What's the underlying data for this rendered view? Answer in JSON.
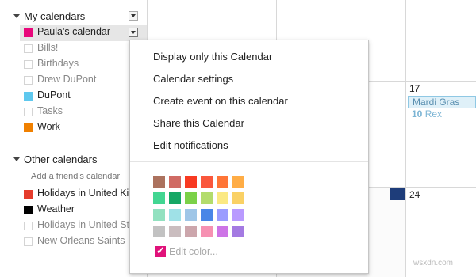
{
  "sidebar": {
    "my_calendars": {
      "title": "My calendars",
      "items": [
        {
          "label": "Paula's calendar",
          "color": "#e8087b",
          "checked": true,
          "active": true
        },
        {
          "label": "Bills!",
          "color": null,
          "checked": false
        },
        {
          "label": "Birthdays",
          "color": null,
          "checked": false
        },
        {
          "label": "Drew DuPont",
          "color": null,
          "checked": false
        },
        {
          "label": "DuPont",
          "color": "#5ec8ee",
          "checked": true
        },
        {
          "label": "Tasks",
          "color": null,
          "checked": false
        },
        {
          "label": "Work",
          "color": "#f08000",
          "checked": true
        }
      ]
    },
    "other_calendars": {
      "title": "Other calendars",
      "friend_placeholder": "Add a friend's calendar",
      "items": [
        {
          "label": "Holidays in United Ki",
          "color": "#e53c2c",
          "checked": true
        },
        {
          "label": "Weather",
          "color": "#000000",
          "checked": true
        },
        {
          "label": "Holidays in United St",
          "color": null,
          "checked": false
        },
        {
          "label": "New Orleans Saints",
          "color": null,
          "checked": false
        }
      ]
    }
  },
  "grid": {
    "day_17": "17",
    "day_24": "24",
    "event": "Mardi Gras",
    "rex_time": "10",
    "rex_title": "Rex"
  },
  "menu": {
    "items": [
      "Display only this Calendar",
      "Calendar settings",
      "Create event on this calendar",
      "Share this Calendar",
      "Edit notifications"
    ],
    "palette": [
      [
        "#ac725e",
        "#d06b64",
        "#f83a22",
        "#fa573c",
        "#ff7537",
        "#ffad46"
      ],
      [
        "#42d692",
        "#16a765",
        "#7bd148",
        "#b3dc6c",
        "#fbe983",
        "#fad165"
      ],
      [
        "#92e1c0",
        "#9fe1e7",
        "#9fc6e7",
        "#4986e7",
        "#9a9cff",
        "#b99aff"
      ],
      [
        "#c2c2c2",
        "#cabdbf",
        "#cca6ac",
        "#f691b2",
        "#cd74e6",
        "#a47ae2"
      ]
    ],
    "edit_color": "Edit color...",
    "accent": "#e0127a"
  },
  "watermark": "wsxdn.com"
}
